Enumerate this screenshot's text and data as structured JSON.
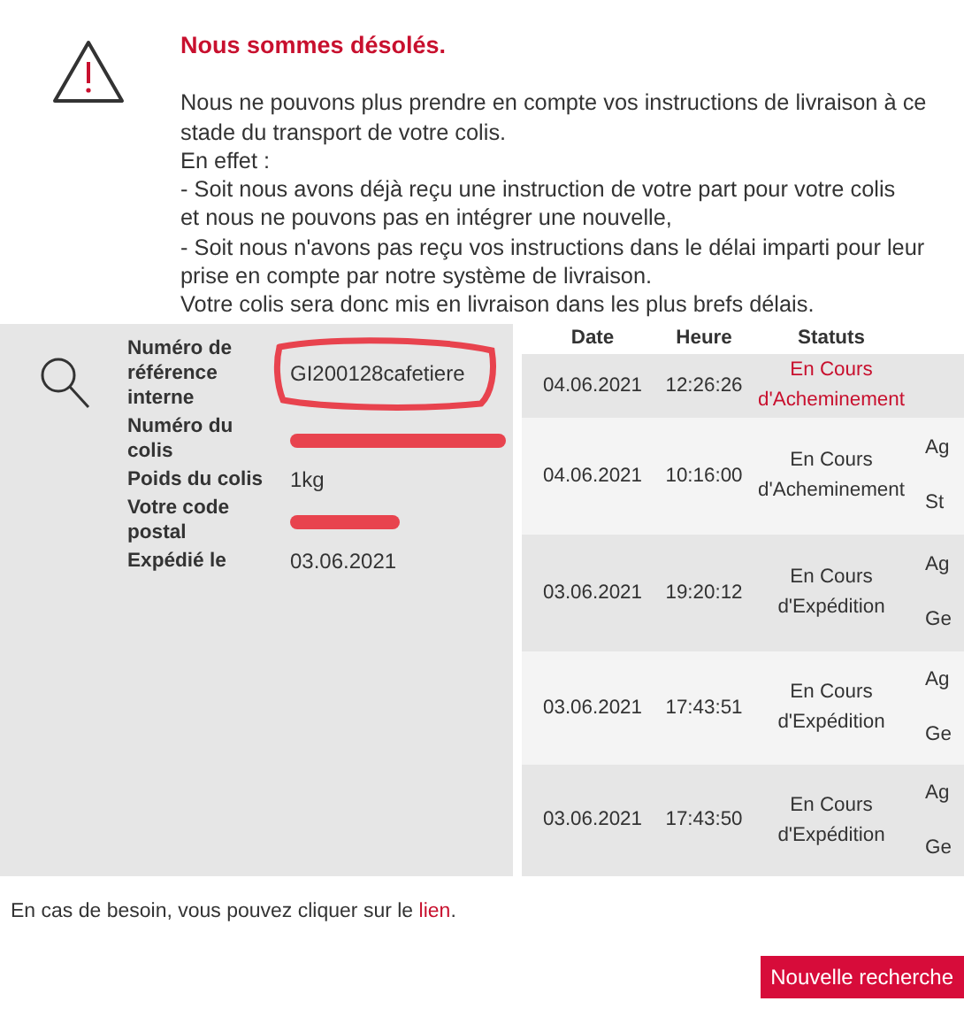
{
  "message": {
    "title": "Nous sommes désolés.",
    "lines": [
      "Nous ne pouvons plus prendre en compte vos instructions de livraison à ce",
      "stade du transport de votre colis.",
      "En effet :",
      "- Soit nous avons déjà reçu une instruction de votre part pour votre colis",
      "et nous ne pouvons pas en intégrer une nouvelle,",
      "- Soit nous n'avons pas reçu vos instructions dans le délai imparti pour leur",
      "prise en compte par notre système de livraison.",
      "Votre colis sera donc mis en livraison dans les plus brefs délais."
    ]
  },
  "details": [
    {
      "label": "Numéro de référence interne",
      "value": "GI200128cafetiere",
      "kind": "circled"
    },
    {
      "label": "Numéro du colis",
      "kind": "redacted"
    },
    {
      "label": "Poids du colis",
      "value": "1kg",
      "kind": "plain"
    },
    {
      "label": "Votre code postal",
      "kind": "redacted"
    },
    {
      "label": "Expédié le",
      "value": "03.06.2021",
      "kind": "plain"
    }
  ],
  "table": {
    "columns": [
      "Date",
      "Heure",
      "Statuts"
    ],
    "rows": [
      {
        "date": "04.06.2021",
        "time": "12:26:26",
        "status": "En Cours d'Acheminement",
        "highlighted": true
      },
      {
        "date": "04.06.2021",
        "time": "10:16:00",
        "status": "En Cours d'Acheminement",
        "highlighted": false,
        "column_4": [
          "Ag",
          "St"
        ]
      },
      {
        "date": "03.06.2021",
        "time": "19:20:12",
        "status": "En Cours d'Expédition",
        "highlighted": false,
        "column_4": [
          "Ag",
          "Ge"
        ]
      },
      {
        "date": "03.06.2021",
        "time": "17:43:51",
        "status": "En Cours d'Expédition",
        "highlighted": false,
        "column_4": [
          "Ag",
          "Ge"
        ]
      },
      {
        "date": "03.06.2021",
        "time": "17:43:50",
        "status": "En Cours d'Expédition",
        "highlighted": false,
        "column_4": [
          "Ag",
          "Ge"
        ]
      }
    ]
  },
  "help": {
    "text": "En cas de besoin, vous pouvez cliquer sur le ",
    "link": "lien",
    "after": "."
  },
  "button": "Nouvelle recherche"
}
